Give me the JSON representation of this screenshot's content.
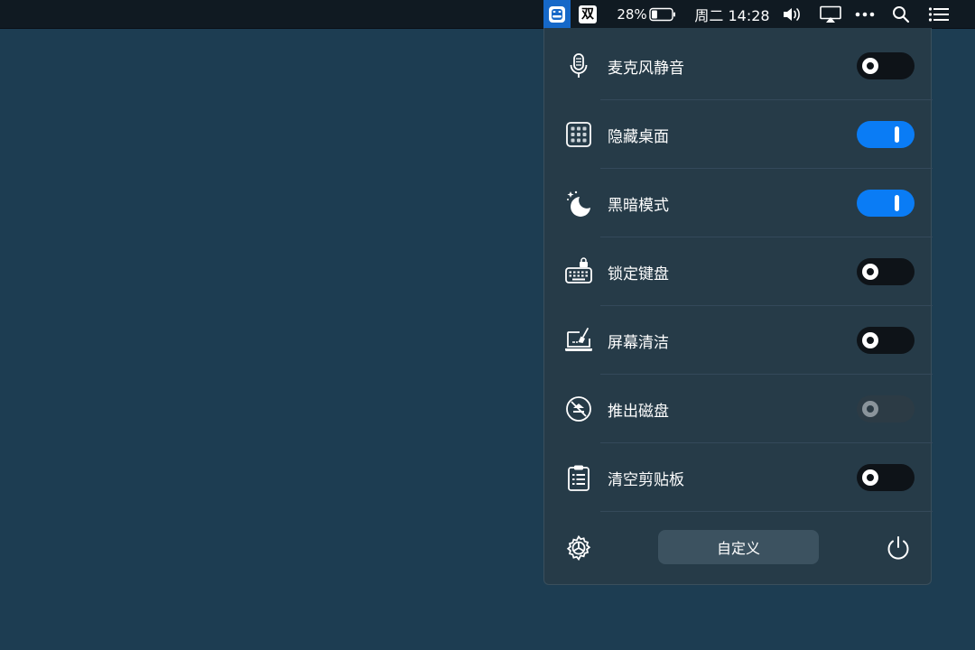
{
  "menubar": {
    "app_icon": "face-toolbox-icon",
    "ime_label": "双",
    "battery_percent": "28%",
    "battery_level": 0.28,
    "clock": "周二 14:28",
    "icons": [
      "volume-icon",
      "airplay-icon",
      "more-icon",
      "search-icon",
      "notification-list-icon"
    ]
  },
  "panel": {
    "items": [
      {
        "label": "麦克风静音",
        "icon": "microphone-icon",
        "state": "off"
      },
      {
        "label": "隐藏桌面",
        "icon": "desktop-grid-icon",
        "state": "on"
      },
      {
        "label": "黑暗模式",
        "icon": "moon-icon",
        "state": "on"
      },
      {
        "label": "锁定键盘",
        "icon": "keyboard-lock-icon",
        "state": "off"
      },
      {
        "label": "屏幕清洁",
        "icon": "screen-clean-icon",
        "state": "off"
      },
      {
        "label": "推出磁盘",
        "icon": "eject-disk-icon",
        "state": "disabled"
      },
      {
        "label": "清空剪贴板",
        "icon": "clipboard-icon",
        "state": "off"
      }
    ],
    "footer": {
      "settings_icon": "gear-icon",
      "customize_label": "自定义",
      "power_icon": "power-icon"
    }
  },
  "colors": {
    "desktop": "#1d3d52",
    "menubar": "#101a22",
    "panel": "#263b48",
    "toggle_on": "#0a7cf5",
    "toggle_off": "#0e1318",
    "app_icon_highlight": "#1668c8"
  }
}
